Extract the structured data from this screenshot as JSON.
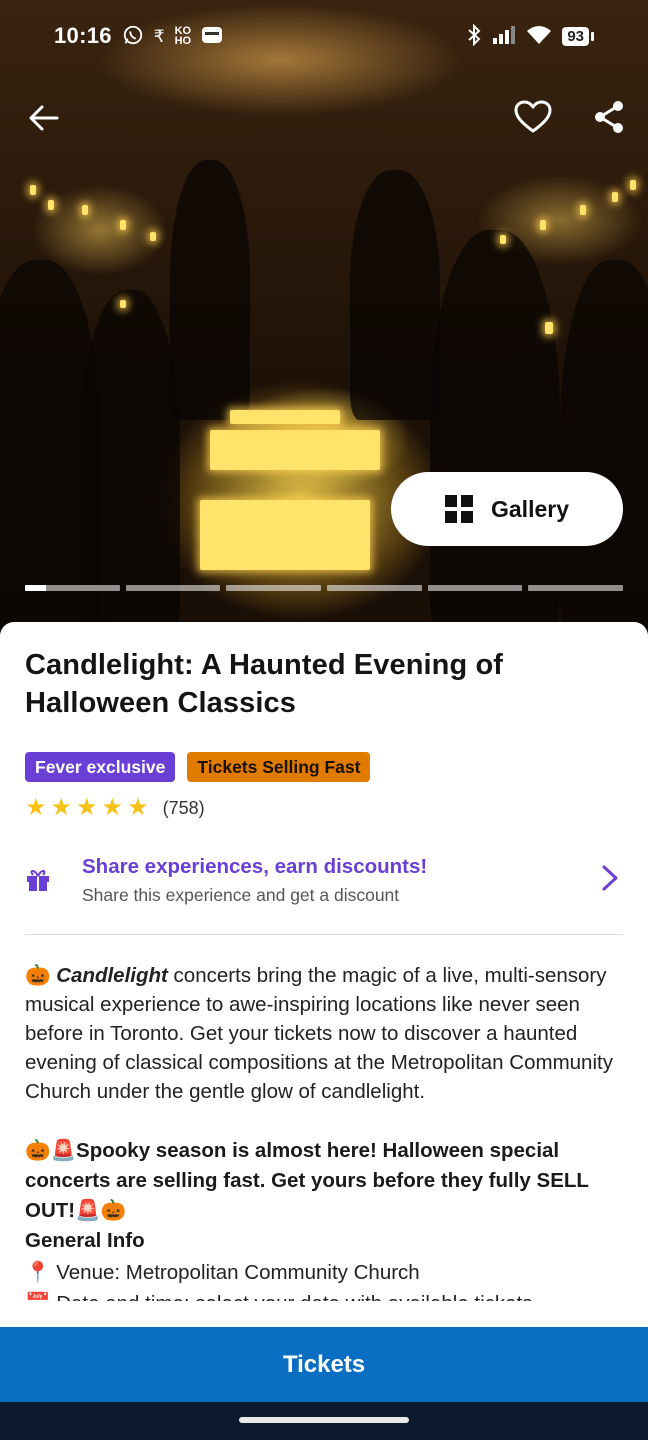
{
  "status_bar": {
    "time": "10:16",
    "left_icons": [
      "whatsapp-icon",
      "rupee-icon",
      "koho-icon",
      "wallet-icon"
    ],
    "koho_text": "KO\nHO",
    "right_icons": [
      "bluetooth-icon",
      "signal-icon",
      "wifi-icon"
    ],
    "battery": "93"
  },
  "header": {
    "back_icon": "arrow-left-icon",
    "favorite_icon": "heart-outline-icon",
    "share_icon": "share-icon"
  },
  "gallery": {
    "label": "Gallery",
    "icon": "grid-icon",
    "slide_count": 6,
    "active_slide": 1,
    "active_progress": 0.22
  },
  "event": {
    "title": "Candlelight: A Haunted Evening of Halloween Classics",
    "badges": {
      "exclusive": "Fever exclusive",
      "selling": "Tickets Selling Fast"
    },
    "rating": {
      "stars": 5,
      "count": "(758)"
    }
  },
  "share_promo": {
    "title": "Share experiences, earn discounts!",
    "subtitle": "Share this experience and get a discount",
    "icon": "gift-icon",
    "chevron": "chevron-right-icon"
  },
  "description": {
    "lead_emoji": "🎃",
    "brand": "Candlelight",
    "body": " concerts bring the magic of a live, multi-sensory musical experience to awe-inspiring locations like never seen before in Toronto. Get your tickets now to discover a haunted evening of classical compositions at the Metropolitan Community Church under the gentle glow of candlelight.",
    "promo": "🎃🚨Spooky season is almost here! Halloween special concerts are selling fast. Get yours before they fully SELL OUT!🚨🎃",
    "general_info_heading": "General Info",
    "venue_line": "📍 Venue: Metropolitan Community Church",
    "cut_line": "📅 Date and time: select your date with available tickets"
  },
  "colors": {
    "accent_purple": "#6a3fd6",
    "badge_orange": "#e07b00",
    "tickets_blue": "#0a6fc2",
    "star_yellow": "#f6c21a"
  },
  "tickets_button": {
    "label": "Tickets"
  }
}
